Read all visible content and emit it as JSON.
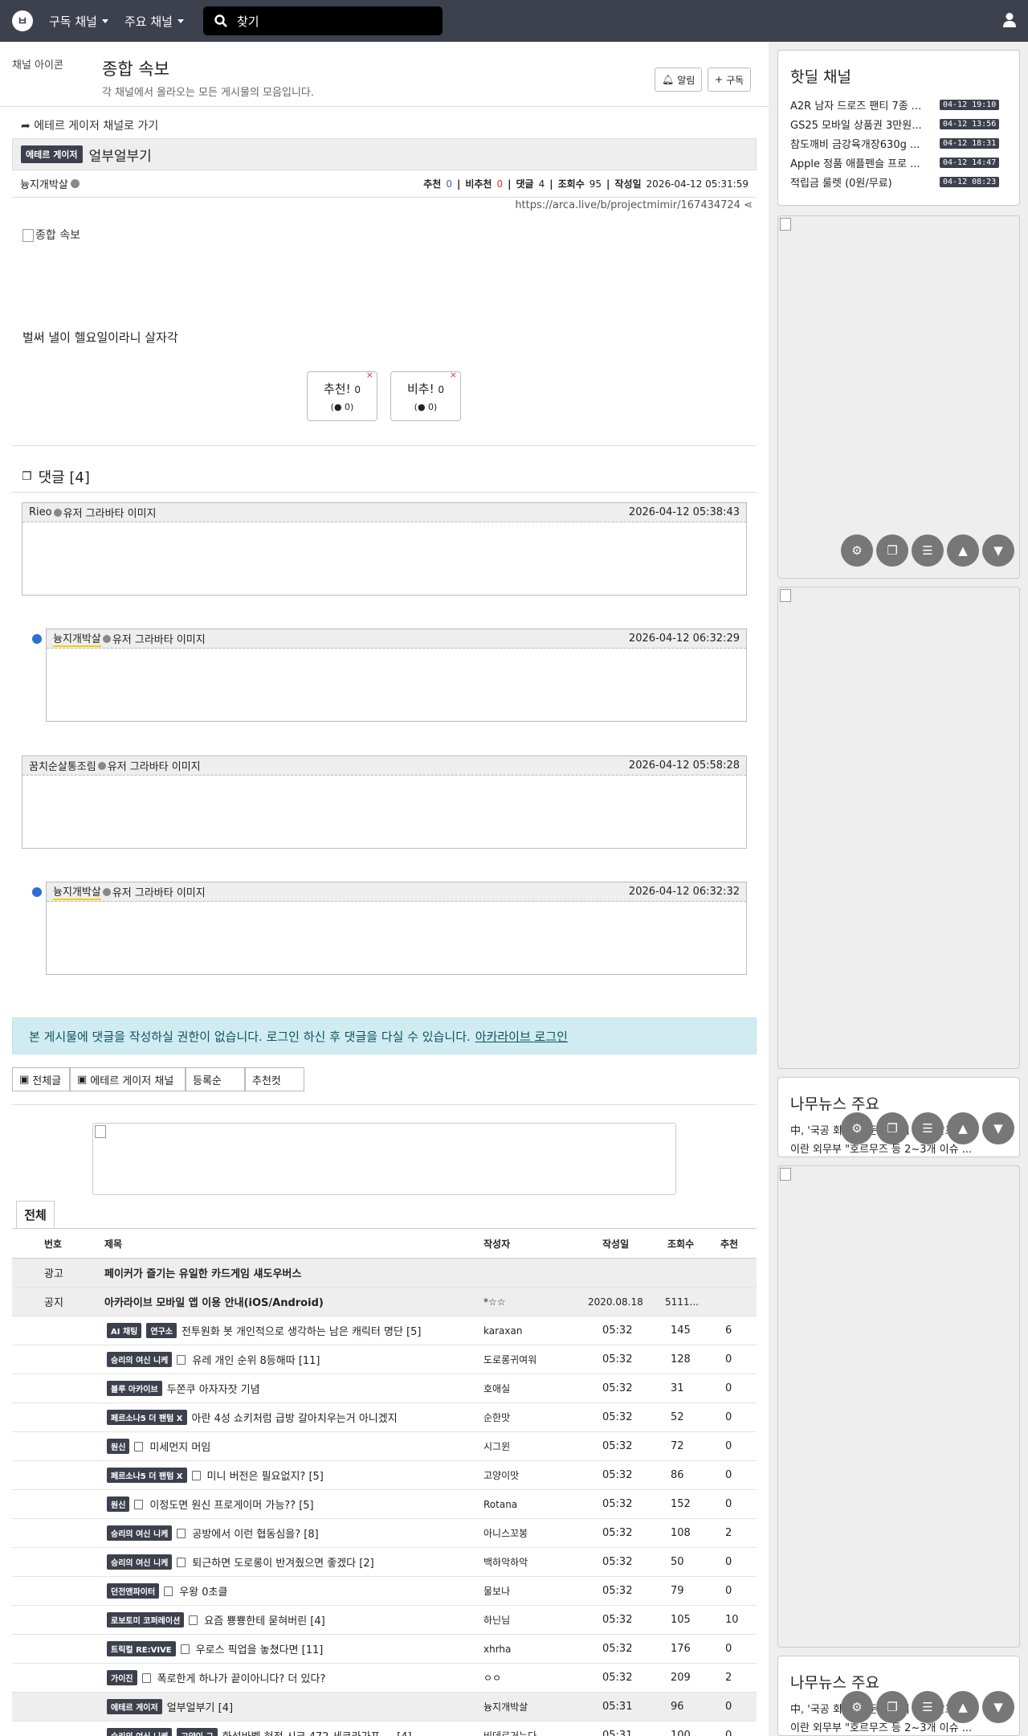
{
  "nav": {
    "menu1": "구독 채널",
    "menu2": "주요 채널",
    "search": "찾기"
  },
  "channel": {
    "img_alt": "채널 아이콘",
    "title": "종합 속보",
    "desc": "각 채널에서 올라오는 모든 게시물의 모음입니다.",
    "alarm": "알림",
    "subscribe": "구독"
  },
  "goback": "에테르 게이저 채널로 가기",
  "post": {
    "category": "에테르 게이저",
    "title": "얼부얼부기",
    "author": "늉지개박살",
    "upvote_label": "추천",
    "upvote": "0",
    "downvote_label": "비추천",
    "downvote": "0",
    "comment_label": "댓글",
    "comments": "4",
    "views_label": "조회수",
    "views": "95",
    "date_label": "작성일",
    "date": "2026-04-12 05:31:59",
    "url": "https://arca.live/b/projectmimir/167434724",
    "img_alt": "종합 속보",
    "text": "벌써 낼이 헬요일이라니 살자각",
    "vote_up": "추천!",
    "vote_up_n": "0",
    "vote_up_sub": "0",
    "vote_down": "비추!",
    "vote_down_n": "0",
    "vote_down_sub": "0"
  },
  "comments_head": "댓글 [4]",
  "comments": [
    {
      "author": "Rieo",
      "avatar": "유저 그라바타 이미지",
      "date": "2026-04-12 05:38:43"
    },
    {
      "author": "늉지개박살",
      "avatar": "유저 그라바타 이미지",
      "date": "2026-04-12 06:32:29"
    },
    {
      "author": "꿈치순살통조림",
      "avatar": "유저 그라바타 이미지",
      "date": "2026-04-12 05:58:28"
    },
    {
      "author": "늉지개박살",
      "avatar": "유저 그라바타 이미지",
      "date": "2026-04-12 06:32:32"
    }
  ],
  "alert": {
    "text": "본 게시물에 댓글을 작성하실 권한이 없습니다. 로그인 하신 후 댓글을 다실 수 있습니다.",
    "link": "아카라이브 로그인"
  },
  "filters": {
    "all": "전체글",
    "channel": "에테르 게이저 채널",
    "sort": "등록순",
    "best": "추천컷"
  },
  "list_tab": "전체",
  "table": {
    "headers": [
      "번호",
      "제목",
      "작성자",
      "작성일",
      "조회수",
      "추천"
    ],
    "pinned": [
      {
        "no": "광고",
        "title": "페이커가 즐기는 유일한 카드게임 섀도우버스",
        "author": "",
        "date": "",
        "views": "",
        "rec": ""
      },
      {
        "no": "공지",
        "title": "아카라이브 모바일 앱 이용 안내(iOS/Android)",
        "author": "*☆☆",
        "date": "2020.08.18",
        "views": "5111...",
        "rec": ""
      }
    ],
    "rows": [
      {
        "badges": [
          "AI 채팅",
          "연구소"
        ],
        "title": "전투원화 봇 개인적으로 생각하는 남은 캐릭터 명단 [5]",
        "author": "karaxan",
        "time": "05:32",
        "views": "145",
        "rec": "6",
        "doc": false
      },
      {
        "badges": [
          "승리의 여신 니케"
        ],
        "title": "유레 개인 순위 8등해따 [11]",
        "author": "도로롱귀여워",
        "time": "05:32",
        "views": "128",
        "rec": "0",
        "doc": true
      },
      {
        "badges": [
          "블루 아카이브"
        ],
        "title": "두쫀쿠 아자자잣 기념",
        "author": "호애실",
        "time": "05:32",
        "views": "31",
        "rec": "0",
        "doc": false
      },
      {
        "badges": [
          "페르소나5 더 팬텀 X"
        ],
        "title": "아란 4성 쇼키처럼 급방 갈아치우는거 아니겠지",
        "author": "순한맛",
        "time": "05:32",
        "views": "52",
        "rec": "0",
        "doc": false
      },
      {
        "badges": [
          "원신"
        ],
        "title": "미세먼지 머임",
        "author": "시그윈",
        "time": "05:32",
        "views": "72",
        "rec": "0",
        "doc": true
      },
      {
        "badges": [
          "페르소나5 더 팬텀 X"
        ],
        "title": "미니 버전은 필요없지? [5]",
        "author": "고양이맛",
        "time": "05:32",
        "views": "86",
        "rec": "0",
        "doc": true
      },
      {
        "badges": [
          "원신"
        ],
        "title": "이정도면 원신 프로게이머 가능?? [5]",
        "author": "Rotana",
        "time": "05:32",
        "views": "152",
        "rec": "0",
        "doc": true
      },
      {
        "badges": [
          "승리의 여신 니케"
        ],
        "title": "공방에서 이런 협동심을? [8]",
        "author": "아니스꼬봉",
        "time": "05:32",
        "views": "108",
        "rec": "2",
        "doc": true
      },
      {
        "badges": [
          "승리의 여신 니케"
        ],
        "title": "퇴근하면 도로롱이 반겨줬으면 좋겠다 [2]",
        "author": "백하악하악",
        "time": "05:32",
        "views": "50",
        "rec": "0",
        "doc": true
      },
      {
        "badges": [
          "던전앤파이터"
        ],
        "title": "우왕 0초클",
        "author": "물보나",
        "time": "05:32",
        "views": "79",
        "rec": "0",
        "doc": true
      },
      {
        "badges": [
          "로보토미 코퍼레이션"
        ],
        "title": "요즘 뿅뿅한테 묻혀버린 [4]",
        "author": "하닌님",
        "time": "05:32",
        "views": "105",
        "rec": "10",
        "doc": true
      },
      {
        "badges": [
          "트릭컬 RE:VIVE"
        ],
        "title": "우로스 픽업을 놓쳤다면 [11]",
        "author": "xhrha",
        "time": "05:32",
        "views": "176",
        "rec": "0",
        "doc": true
      },
      {
        "badges": [
          "가이진"
        ],
        "title": "폭로한게 하나가 끝이아니다? 더 있다?",
        "author": "ㅇㅇ",
        "time": "05:32",
        "views": "209",
        "rec": "2",
        "doc": true
      },
      {
        "badges": [
          "에테르 게이저"
        ],
        "title": "얼부얼부기 [4]",
        "author": "늉지개박살",
        "time": "05:31",
        "views": "96",
        "rec": "0",
        "doc": false,
        "gray": true
      },
      {
        "badges": [
          "승리의 여신 니케",
          "고양이 그"
        ],
        "title": "화석바벨 혀적 시크 472 세코라가포 ... [4]",
        "author": "비데르거누다",
        "time": "05:31",
        "views": "100",
        "rec": "0",
        "doc": false
      }
    ]
  },
  "side": {
    "hotdeal_title": "핫딜 채널",
    "hotdeals": [
      {
        "text": "A2R 남자 드로즈 팬티 7종 ...",
        "date": "04-12 19:10"
      },
      {
        "text": "GS25 모바일 상품권 3만원...",
        "date": "04-12 13:56"
      },
      {
        "text": "참도깨비 금강육개장630g ...",
        "date": "04-12 18:31"
      },
      {
        "text": "Apple 정품 애플펜슬 프로 ...",
        "date": "04-12 14:47"
      },
      {
        "text": "적립금 룰렛 (0원/무료)",
        "date": "04-12 08:23"
      }
    ],
    "news_title": "나무뉴스 주요",
    "news_text1": "中, '국공 회담' 앞둔 대만에 선물 발표",
    "news_text2": "이란 외무부 \"호르무즈 등 2~3개 이슈 ...",
    "news2_title": "나무뉴스 주요",
    "news2_text1": "中, '국공 회담' 앞둔 대만에 선물 발표",
    "news2_text2": "이란 외무부 \"호르무즈 등 2~3개 이슈 ..."
  }
}
